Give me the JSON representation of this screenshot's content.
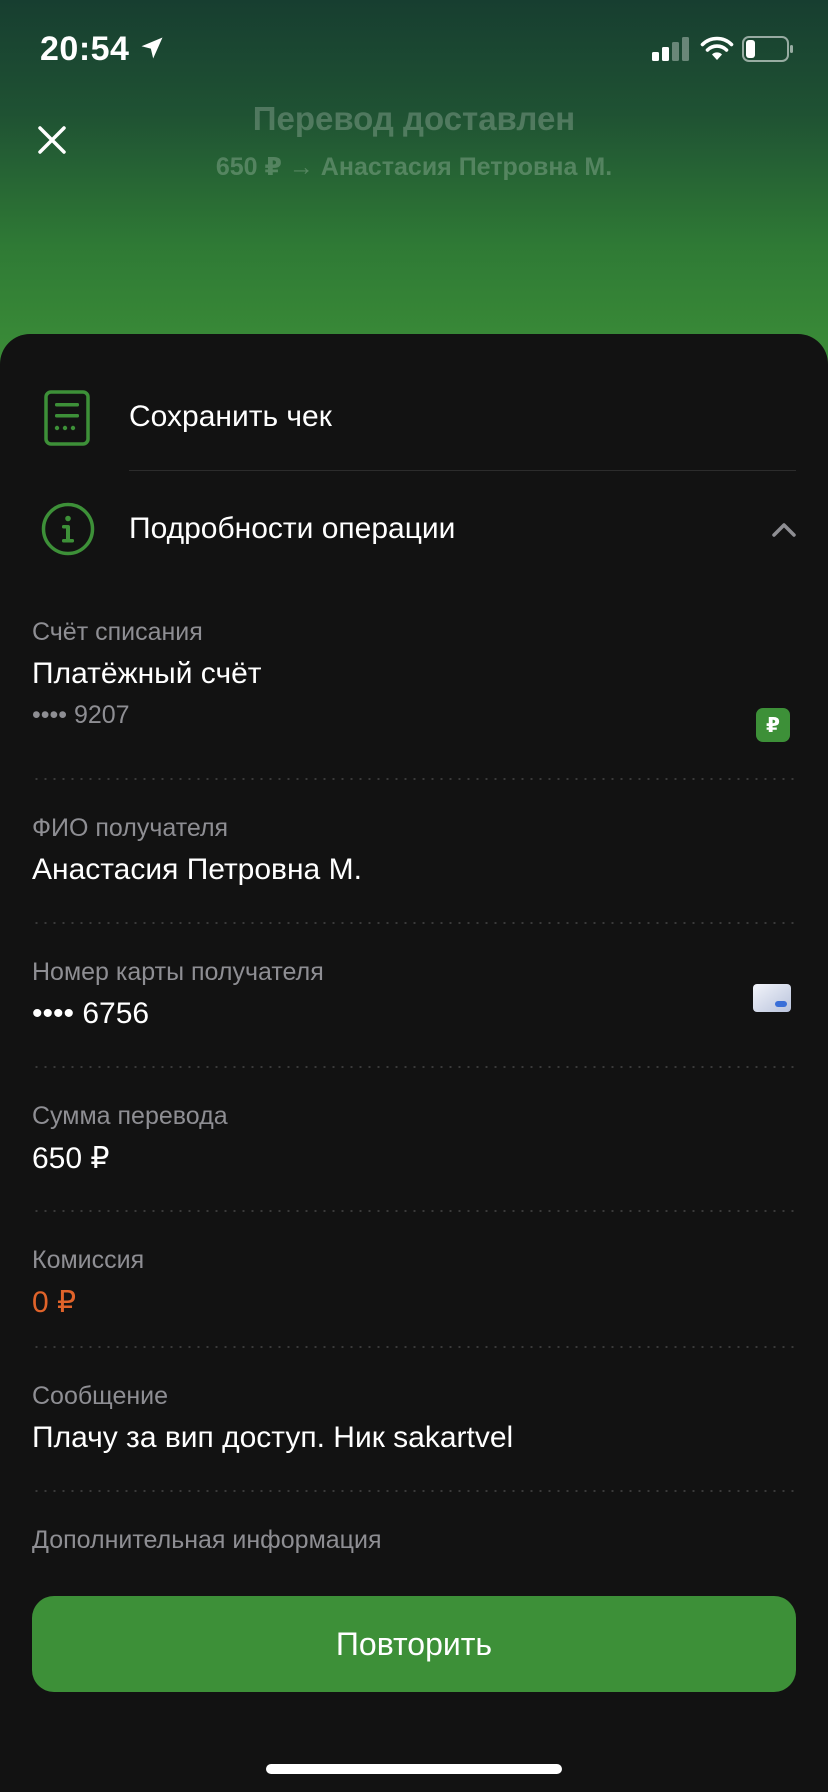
{
  "status_bar": {
    "time": "20:54"
  },
  "header": {
    "title": "Перевод доставлен",
    "subtitle": "650 ₽ → Анастасия Петровна М."
  },
  "actions": {
    "save_receipt": "Сохранить чек",
    "details": "Подробности операции"
  },
  "fields": {
    "debit_account": {
      "label": "Счёт списания",
      "value": "Платёжный счёт",
      "sub": "•••• 9207",
      "badge": "₽"
    },
    "recipient_name": {
      "label": "ФИО получателя",
      "value": "Анастасия Петровна М."
    },
    "recipient_card": {
      "label": "Номер карты получателя",
      "value": "•••• 6756"
    },
    "amount": {
      "label": "Сумма перевода",
      "value": "650 ₽"
    },
    "commission": {
      "label": "Комиссия",
      "value": "0 ₽"
    },
    "message": {
      "label": "Сообщение",
      "value": "Плачу за вип доступ. Ник sakartvel"
    },
    "extra_info": {
      "label": "Дополнительная информация"
    }
  },
  "buttons": {
    "repeat": "Повторить"
  },
  "colors": {
    "accent": "#3d9038",
    "commission": "#e0632a",
    "background": "#121212"
  },
  "icons": [
    "location-arrow-icon",
    "signal-icon",
    "wifi-icon",
    "battery-icon",
    "close-icon",
    "receipt-icon",
    "info-icon",
    "chevron-up-icon",
    "ruble-badge-icon",
    "card-icon"
  ]
}
